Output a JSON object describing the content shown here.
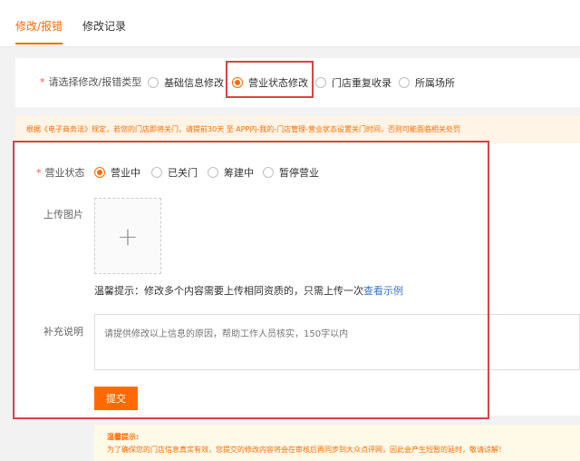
{
  "tabs": [
    {
      "label": "修改/报错",
      "active": true
    },
    {
      "label": "修改记录",
      "active": false
    }
  ],
  "type_row": {
    "label": "请选择修改/报错类型",
    "options": [
      {
        "label": "基础信息修改",
        "checked": false
      },
      {
        "label": "营业状态修改",
        "checked": true
      },
      {
        "label": "门店重复收录",
        "checked": false
      },
      {
        "label": "所属场所",
        "checked": false
      }
    ]
  },
  "notice": "根据《电子商务法》规定，若您的门店即将关门，请提前30天 至 APP内-我的-门店管理-营业状态设置关门时间，否则可能面临相关处罚",
  "form": {
    "status_label": "营业状态",
    "status_options": [
      {
        "label": "营业中",
        "checked": true
      },
      {
        "label": "已关门",
        "checked": false
      },
      {
        "label": "筹建中",
        "checked": false
      },
      {
        "label": "暂停营业",
        "checked": false
      }
    ],
    "upload_label": "上传图片",
    "upload_plus": "+",
    "tip_text": "温馨提示：修改多个内容需要上传相同资质的，只需上传一次",
    "tip_link": "查看示例",
    "note_label": "补充说明",
    "note_placeholder": "请提供修改以上信息的原因，帮助工作人员核实，150字以内",
    "submit_label": "提交"
  },
  "bottom_tip": {
    "title": "温馨提示:",
    "text": "为了确保您的门店信息真实有效，您提交的修改内容将会在审核后再同步到大众点评网，因此会产生短暂的延时，敬请谅解！"
  },
  "colors": {
    "accent": "#ff6a00",
    "highlight": "#d9434a",
    "link": "#3a72c9"
  }
}
